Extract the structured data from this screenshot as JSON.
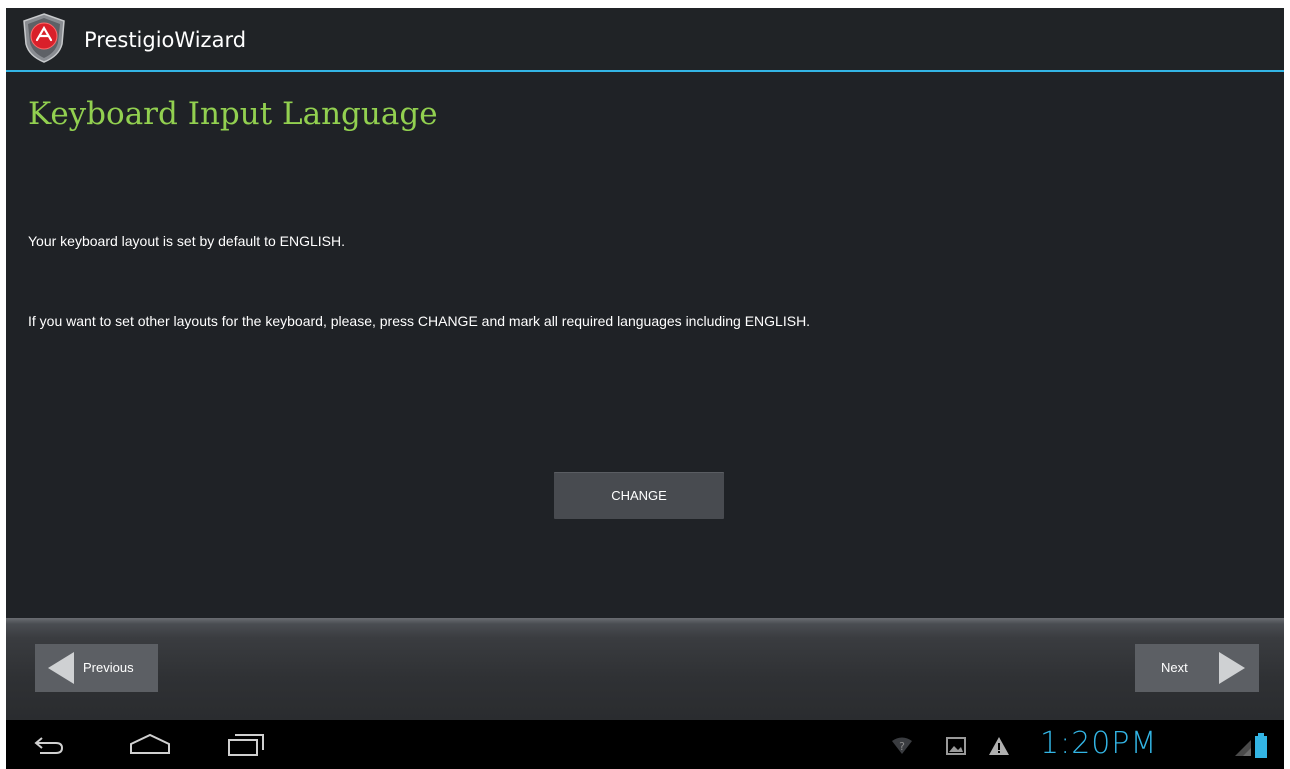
{
  "app": {
    "title": "PrestigioWizard",
    "icon": "prestigio-shield-icon"
  },
  "page": {
    "heading": "Keyboard Input Language",
    "paragraphs": [
      "Your keyboard layout is set by default to ENGLISH.",
      "If you want to set other layouts for the keyboard, please, press CHANGE and mark all required languages including ENGLISH."
    ],
    "change_label": "CHANGE"
  },
  "wizard_nav": {
    "previous_label": "Previous",
    "next_label": "Next"
  },
  "system_bar": {
    "nav_icons": [
      "back-icon",
      "home-icon",
      "recent-apps-icon"
    ],
    "status_icons": [
      "wifi-icon",
      "gallery-notification-icon",
      "warning-icon",
      "signal-icon",
      "battery-icon"
    ],
    "time": "1:20PM"
  },
  "colors": {
    "heading": "#92d050",
    "accent": "#33b5e5",
    "background": "#1f2226",
    "button": "#484b50"
  }
}
